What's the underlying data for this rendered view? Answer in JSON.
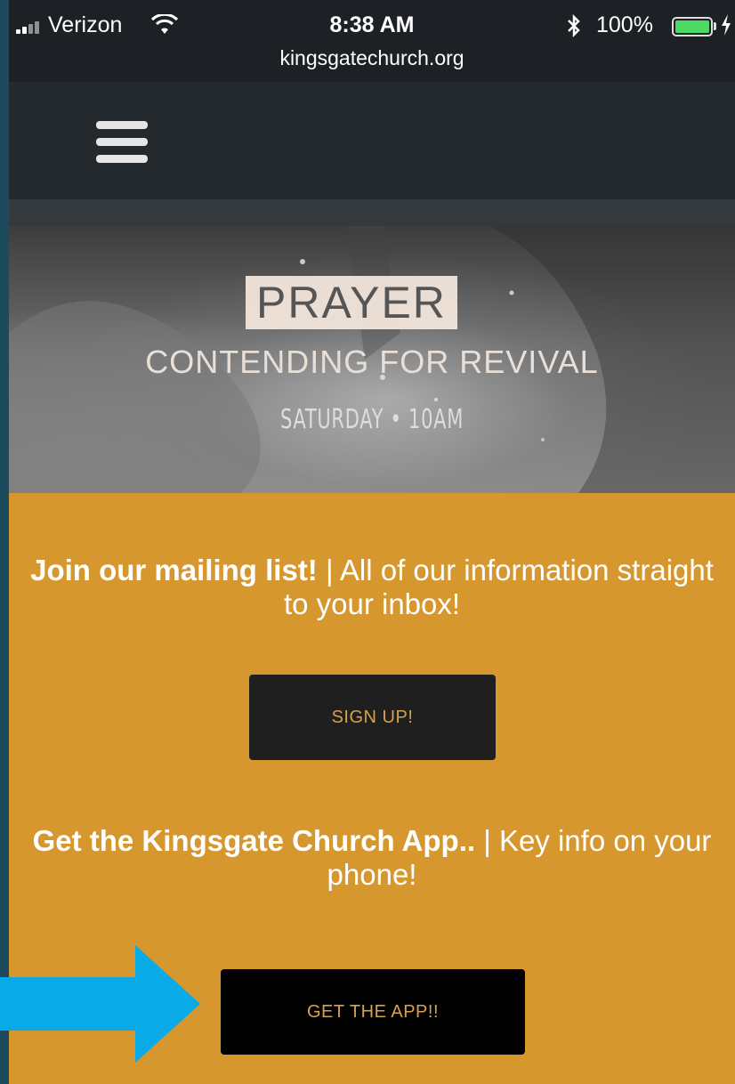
{
  "status_bar": {
    "carrier": "Verizon",
    "time": "8:38 AM",
    "url": "kingsgatechurch.org",
    "battery": "100%"
  },
  "hero": {
    "title": "PRAYER",
    "subtitle": "CONTENDING FOR REVIVAL",
    "schedule": "SATURDAY • 10AM"
  },
  "mailing": {
    "heading": "Join our mailing list!",
    "text": " | All of our information straight to your inbox!",
    "button": "SIGN UP!"
  },
  "app": {
    "heading": "Get the Kingsgate Church App..",
    "text": " | Key info on your phone!",
    "button": "GET THE APP!!"
  },
  "colors": {
    "accent": "#d7972f",
    "arrow": "#0aaae6",
    "dark": "#24292d"
  }
}
